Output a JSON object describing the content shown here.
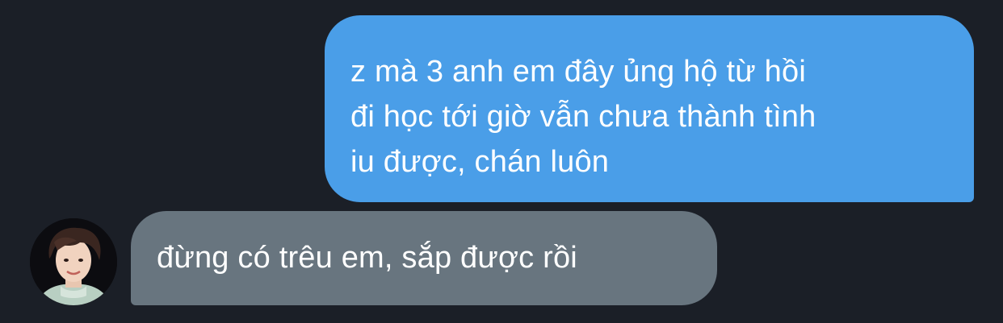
{
  "conversation": {
    "messages": [
      {
        "direction": "sent",
        "lines": [
          "z mà 3 anh em đây ủng hộ từ hồi",
          "đi học tới giờ vẫn chưa thành tình",
          "iu được, chán luôn"
        ]
      },
      {
        "direction": "received",
        "lines": [
          "đừng có trêu em, sắp được rồi"
        ]
      }
    ],
    "avatar_icon": "user-photo-avatar"
  },
  "colors": {
    "background": "#1b1f27",
    "sent_bubble": "#4a9ee8",
    "received_bubble": "#68757f",
    "text": "#ffffff"
  }
}
